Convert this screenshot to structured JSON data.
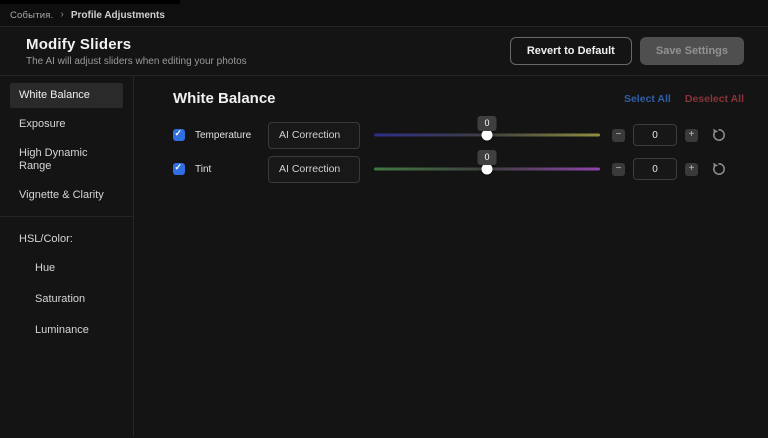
{
  "breadcrumb": {
    "root": "События.",
    "separator": "›",
    "current": "Profile Adjustments"
  },
  "header": {
    "title": "Modify Sliders",
    "subtitle": "The AI will adjust sliders when editing your photos",
    "revert_label": "Revert to Default",
    "save_label": "Save Settings"
  },
  "sidebar": {
    "items": [
      {
        "label": "White Balance",
        "selected": true
      },
      {
        "label": "Exposure"
      },
      {
        "label": "High Dynamic Range"
      },
      {
        "label": "Vignette & Clarity"
      },
      {
        "label": "HSL/Color:"
      },
      {
        "label": "Hue"
      },
      {
        "label": "Saturation"
      },
      {
        "label": "Luminance"
      }
    ]
  },
  "main": {
    "section_title": "White Balance",
    "select_all_label": "Select All",
    "deselect_all_label": "Deselect All",
    "minus_label": "−",
    "plus_label": "+",
    "rows": [
      {
        "label": "Temperature",
        "checked": true,
        "mode": "AI Correction",
        "tooltip": "0",
        "value": "0",
        "slider_pos_pct": 50,
        "track_left_color": "#2e2e8a",
        "track_mid_color": "#3f3f3f",
        "track_right_color": "#8f8f3f"
      },
      {
        "label": "Tint",
        "checked": true,
        "mode": "AI Correction",
        "tooltip": "0",
        "value": "0",
        "slider_pos_pct": 50,
        "track_left_color": "#3f7a42",
        "track_mid_color": "#3f3f3f",
        "track_right_color": "#9043ad"
      }
    ]
  },
  "colors": {
    "accent_checkbox": "#2f6fe0",
    "select_all": "#2e5ea8",
    "deselect_all": "#8a3338",
    "background": "#141414"
  }
}
